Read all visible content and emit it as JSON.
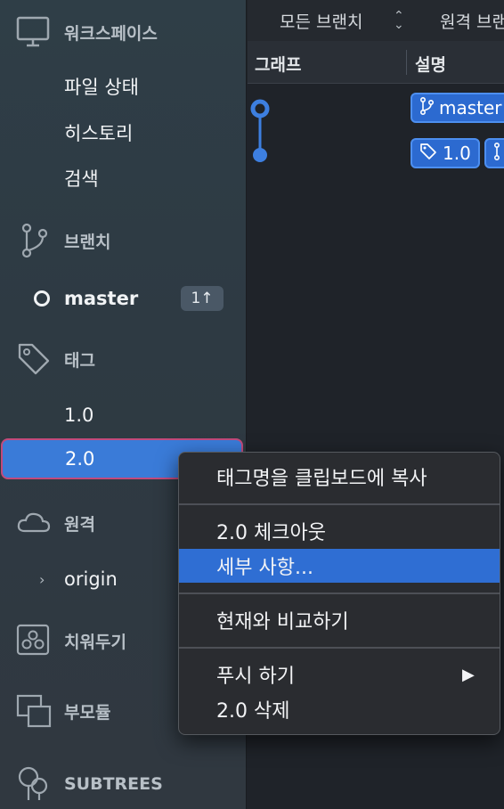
{
  "sidebar": {
    "workspace": {
      "label": "워크스페이스",
      "icon": "monitor-icon"
    },
    "workspace_items": [
      "파일 상태",
      "히스토리",
      "검색"
    ],
    "branches": {
      "label": "브랜치",
      "icon": "branch-icon"
    },
    "current_branch": {
      "label": "master",
      "badge": "1↑"
    },
    "tags": {
      "label": "태그",
      "icon": "tag-icon"
    },
    "tag_items": [
      "1.0",
      "2.0"
    ],
    "remotes": {
      "label": "원격",
      "icon": "cloud-icon"
    },
    "remote_items": [
      "origin"
    ],
    "stashes": {
      "label": "치워두기",
      "icon": "stash-icon"
    },
    "submodules": {
      "label": "부모듈",
      "icon": "submodule-icon"
    },
    "subtrees": {
      "label": "SUBTREES",
      "icon": "subtree-icon"
    }
  },
  "toolbar": {
    "branch_filter": "모든 브랜치",
    "remote_filter": "원격 브랜"
  },
  "columns": {
    "graph": "그래프",
    "description": "설명"
  },
  "commits": [
    {
      "chips": [
        "master"
      ]
    },
    {
      "chips": [
        "1.0",
        ""
      ]
    }
  ],
  "context_menu": {
    "items": [
      "태그명을 클립보드에 복사",
      "2.0 체크아웃",
      "세부 사항...",
      "현재와 비교하기",
      "푸시 하기",
      "2.0 삭제"
    ],
    "submenu_arrow": "▶"
  },
  "colors": {
    "selection": "#3a7bd8",
    "menu_highlight": "#2f6ed3",
    "chip": "#2c6ad0",
    "graph": "#3d7fe0"
  }
}
